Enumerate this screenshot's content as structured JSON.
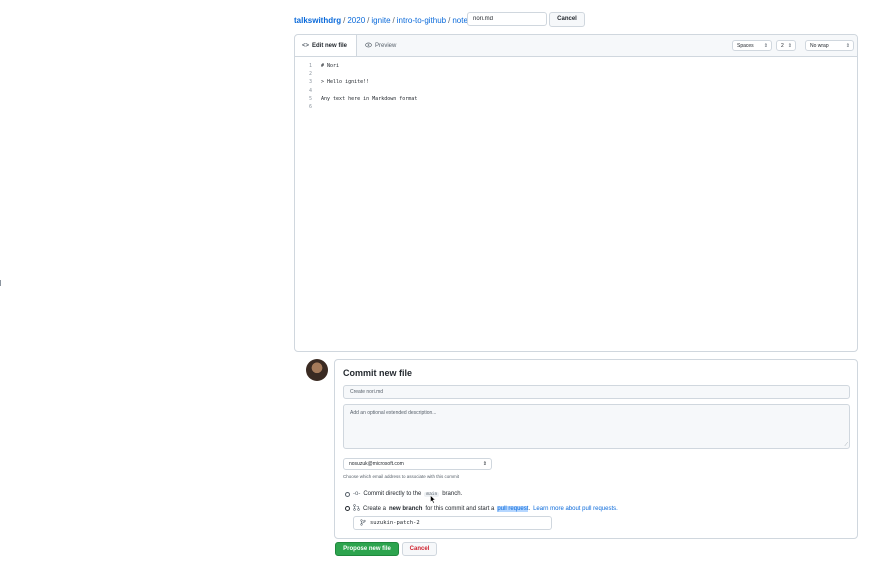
{
  "breadcrumb": {
    "owner": "talkswithdrg",
    "parts": [
      "2020",
      "ignite",
      "intro-to-github",
      "notes"
    ],
    "separator": "/"
  },
  "filename_value": "nori.md",
  "top_cancel": "Cancel",
  "editor": {
    "tab_edit": "Edit new file",
    "tab_preview": "Preview",
    "indent_mode": "Spaces",
    "indent_size": "2",
    "wrap_mode": "No wrap",
    "lines": [
      {
        "n": "1",
        "text": "# Nori"
      },
      {
        "n": "2",
        "text": ""
      },
      {
        "n": "3",
        "text": "> Hello ignite!!"
      },
      {
        "n": "4",
        "text": ""
      },
      {
        "n": "5",
        "text": "Any text here in Markdown format"
      },
      {
        "n": "6",
        "text": ""
      }
    ]
  },
  "commit": {
    "title": "Commit new file",
    "summary_placeholder": "Create nori.md",
    "description_placeholder": "Add an optional extended description...",
    "email": "nosuzuk@microsoft.com",
    "email_hint": "Choose which email address to associate with this commit",
    "option_direct_prefix": "Commit directly to the",
    "option_direct_branch": "main",
    "option_direct_suffix": "branch.",
    "option_new_prefix": "Create a",
    "option_new_bold": "new branch",
    "option_new_middle": "for this commit and start a",
    "option_new_highlight": "pull request",
    "option_new_dot": ".",
    "option_new_link": "Learn more about pull requests.",
    "branch_name": "suzukin-patch-2",
    "propose_button": "Propose new file",
    "cancel_button": "Cancel"
  },
  "colors": {
    "link": "#0969da",
    "primary_button": "#2da44e",
    "danger": "#cf222e"
  }
}
